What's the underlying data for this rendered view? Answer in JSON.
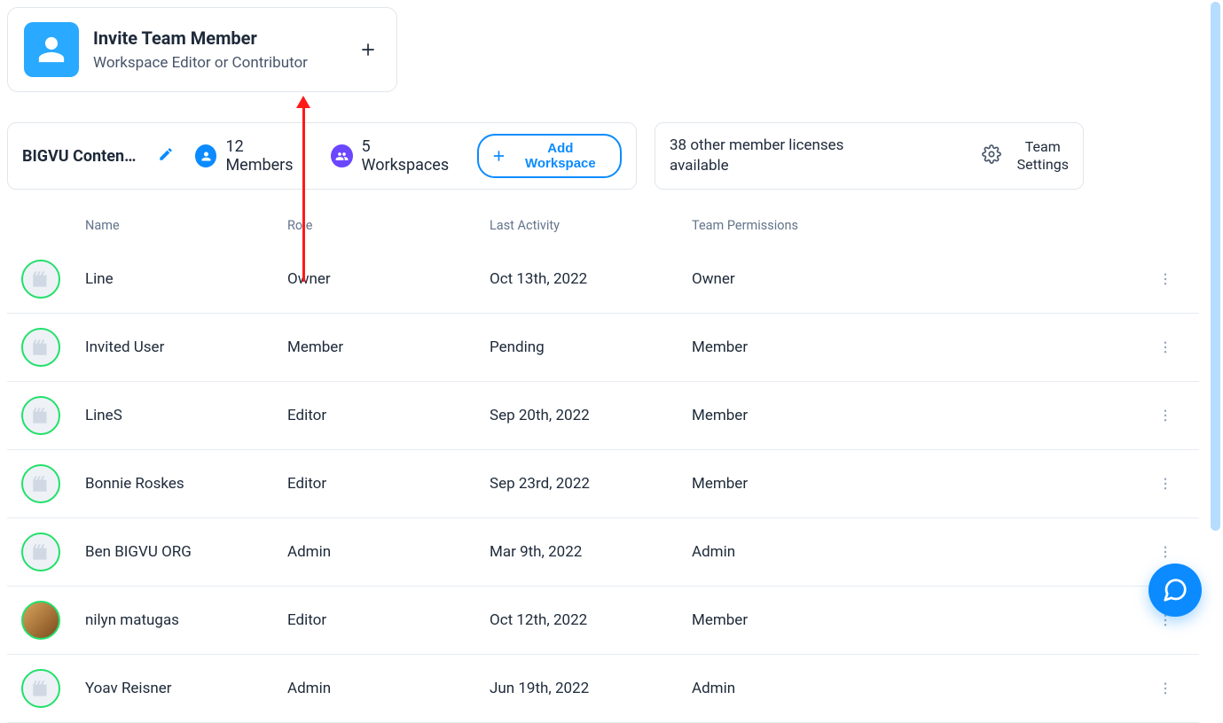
{
  "invite_card": {
    "title": "Invite Team Member",
    "subtitle": "Workspace Editor or Contributor"
  },
  "info_bar": {
    "workspace_name": "BIGVU Content...",
    "members_label": "12 Members",
    "workspaces_label": "5 Workspaces",
    "add_workspace_label": "Add Workspace",
    "licenses_text": "38 other member licenses available",
    "team_settings_label": "Team Settings"
  },
  "columns": {
    "name": "Name",
    "role": "Role",
    "last_activity": "Last Activity",
    "team_permissions": "Team Permissions"
  },
  "members": [
    {
      "name": "Line",
      "role": "Owner",
      "last_activity": "Oct 13th, 2022",
      "permissions": "Owner",
      "avatar": "default"
    },
    {
      "name": "Invited User",
      "role": "Member",
      "last_activity": "Pending",
      "permissions": "Member",
      "avatar": "default"
    },
    {
      "name": "LineS",
      "role": "Editor",
      "last_activity": "Sep 20th, 2022",
      "permissions": "Member",
      "avatar": "default"
    },
    {
      "name": "Bonnie Roskes",
      "role": "Editor",
      "last_activity": "Sep 23rd, 2022",
      "permissions": "Member",
      "avatar": "default"
    },
    {
      "name": "Ben BIGVU ORG",
      "role": "Admin",
      "last_activity": "Mar 9th, 2022",
      "permissions": "Admin",
      "avatar": "default"
    },
    {
      "name": "nilyn matugas",
      "role": "Editor",
      "last_activity": "Oct 12th, 2022",
      "permissions": "Member",
      "avatar": "photo"
    },
    {
      "name": "Yoav Reisner",
      "role": "Admin",
      "last_activity": "Jun 19th, 2022",
      "permissions": "Admin",
      "avatar": "default"
    }
  ]
}
